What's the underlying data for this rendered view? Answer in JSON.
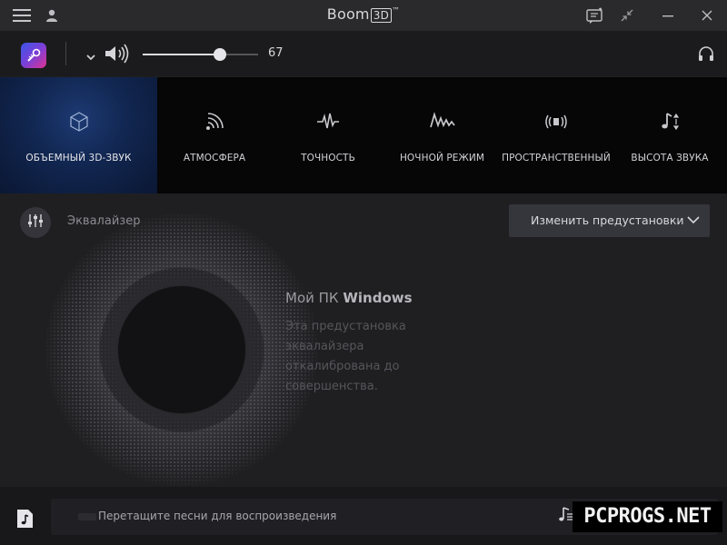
{
  "window": {
    "title": "Boom",
    "title_badge": "3D",
    "title_tm": "™"
  },
  "volume": {
    "value": "67",
    "level": 0.67
  },
  "effects": [
    {
      "label": "ОБЪЕМНЫЙ 3D-ЗВУК",
      "icon": "cube-icon",
      "active": true
    },
    {
      "label": "АТМОСФЕРА",
      "icon": "ambience-waves-icon",
      "active": false
    },
    {
      "label": "ТОЧНОСТЬ",
      "icon": "fidelity-pulse-icon",
      "active": false
    },
    {
      "label": "НОЧНОЙ РЕЖИМ",
      "icon": "night-mode-wave-icon",
      "active": false
    },
    {
      "label": "ПРОСТРАНСТВЕННЫЙ",
      "icon": "spatial-icon",
      "active": false
    },
    {
      "label": "ВЫСОТА ЗВУКА",
      "icon": "pitch-note-icon",
      "active": false
    }
  ],
  "equalizer": {
    "label": "Эквалайзер",
    "preset_button": "Изменить предустановки",
    "preset_name_prefix": "Мой ПК",
    "preset_name_bold": "Windows",
    "preset_description": "Эта предустановка эквалайзера откалиброванa до совершенства."
  },
  "player": {
    "drop_text": "Перетащите песни для воспроизведения"
  },
  "watermark": "PCPROGS.NET",
  "colors": {
    "active_effect": "#112650",
    "background": "#1f1f22",
    "effects_bar": "#060607"
  }
}
